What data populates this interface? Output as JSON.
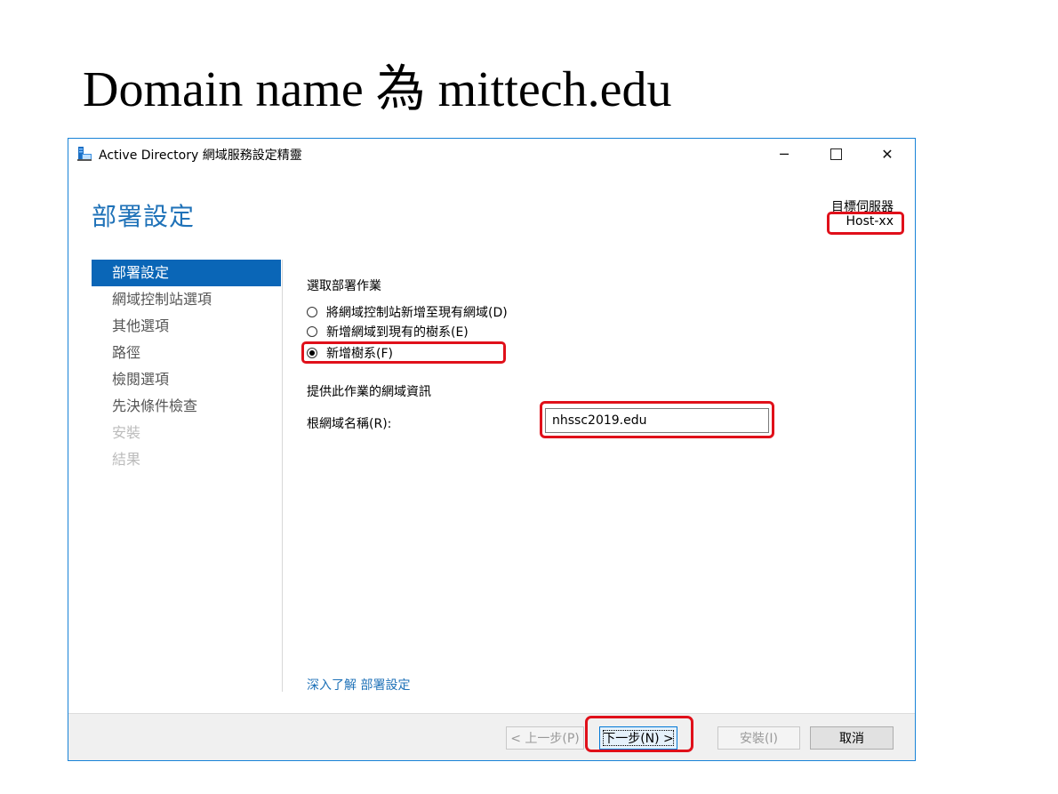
{
  "slide_title": "Domain name 為 mittech.edu",
  "window": {
    "title": "Active Directory 網域服務設定精靈",
    "controls": {
      "minimize": "─",
      "close": "✕"
    }
  },
  "page_heading": "部署設定",
  "target_server": {
    "label": "目標伺服器",
    "value": "Host-xx"
  },
  "nav": {
    "items": [
      {
        "label": "部署設定",
        "state": "active"
      },
      {
        "label": "網域控制站選項",
        "state": "normal"
      },
      {
        "label": "其他選項",
        "state": "normal"
      },
      {
        "label": "路徑",
        "state": "normal"
      },
      {
        "label": "檢閱選項",
        "state": "normal"
      },
      {
        "label": "先決條件檢查",
        "state": "normal"
      },
      {
        "label": "安裝",
        "state": "disabled"
      },
      {
        "label": "結果",
        "state": "disabled"
      }
    ]
  },
  "deployment": {
    "section_label": "選取部署作業",
    "options": [
      {
        "label": "將網域控制站新增至現有網域(D)",
        "checked": false
      },
      {
        "label": "新增網域到現有的樹系(E)",
        "checked": false
      },
      {
        "label": "新增樹系(F)",
        "checked": true
      }
    ]
  },
  "domain_info": {
    "section_label": "提供此作業的網域資訊",
    "root_label": "根網域名稱(R):",
    "root_value": "nhssc2019.edu"
  },
  "learn_more": "深入了解 部署設定",
  "buttons": {
    "back": "< 上一步(P)",
    "next": "下一步(N) >",
    "install": "安裝(I)",
    "cancel": "取消"
  },
  "highlight_color": "#e0101a",
  "accent_color": "#0a66b7"
}
